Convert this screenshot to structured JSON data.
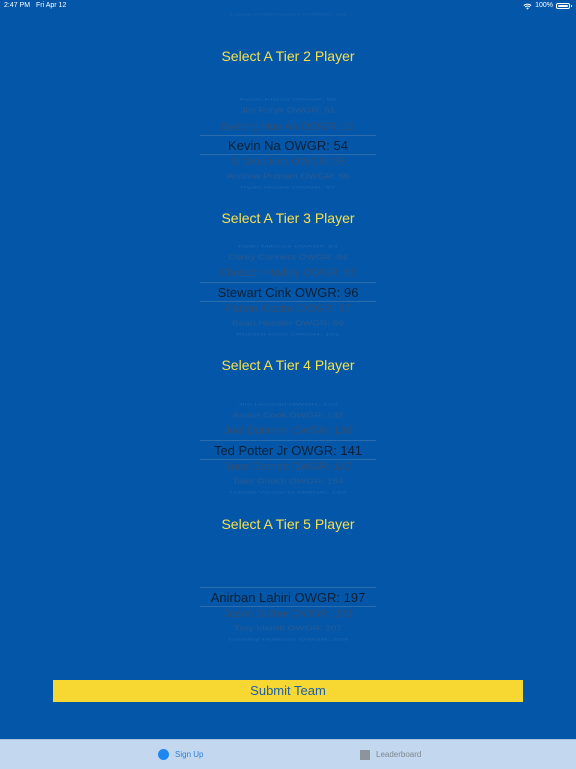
{
  "status": {
    "time": "2:47 PM",
    "date": "Fri Apr 12",
    "battery": "100%"
  },
  "tiers": [
    {
      "title": "Select A Tier 2 Player",
      "options": [
        "Kevin Kisner OWGR: 50",
        "Jim Furyk OWGR: 51",
        "Byeong Hun An OWGR: 52",
        "Kevin Na OWGR: 54",
        "Si Woo Kim OWGR: 55",
        "Andrew Putnam OWGR: 56",
        "Ryan Moore OWGR: 57"
      ]
    },
    {
      "title": "Select A Tier 3 Player",
      "options": [
        "Keith Mitchell OWGR: 83",
        "Corey Conners OWGR: 84",
        "Chesson Hadley OWGR: 86",
        "Stewart Cink OWGR: 96",
        "Patton Kizzire OWGR: 97",
        "Beau Hossler OWGR: 99",
        "Russell Knox OWGR: 101"
      ]
    },
    {
      "title": "Select A Tier 4 Player",
      "options": [
        "Jim Herman OWGR: 128",
        "Austin Cook OWGR: 132",
        "Joel Dahmen OWGR: 136",
        "Ted Potter Jr OWGR: 141",
        "Brice Garnett OWGR: 147",
        "Talor Gooch OWGR: 154",
        "Harold Varner III OWGR: 159"
      ]
    },
    {
      "title": "Select A Tier 5 Player",
      "options": [
        "Anirban Lahiri OWGR: 197",
        "Jason Dufner OWGR: 203",
        "Troy Merritt OWGR: 207",
        "Charley Hoffman OWGR: 209"
      ]
    }
  ],
  "top_residual": "Louis Oosthuizen OWGR: 28",
  "submit_label": "Submit Team",
  "tabs": {
    "signup": "Sign Up",
    "leaderboard": "Leaderboard"
  }
}
